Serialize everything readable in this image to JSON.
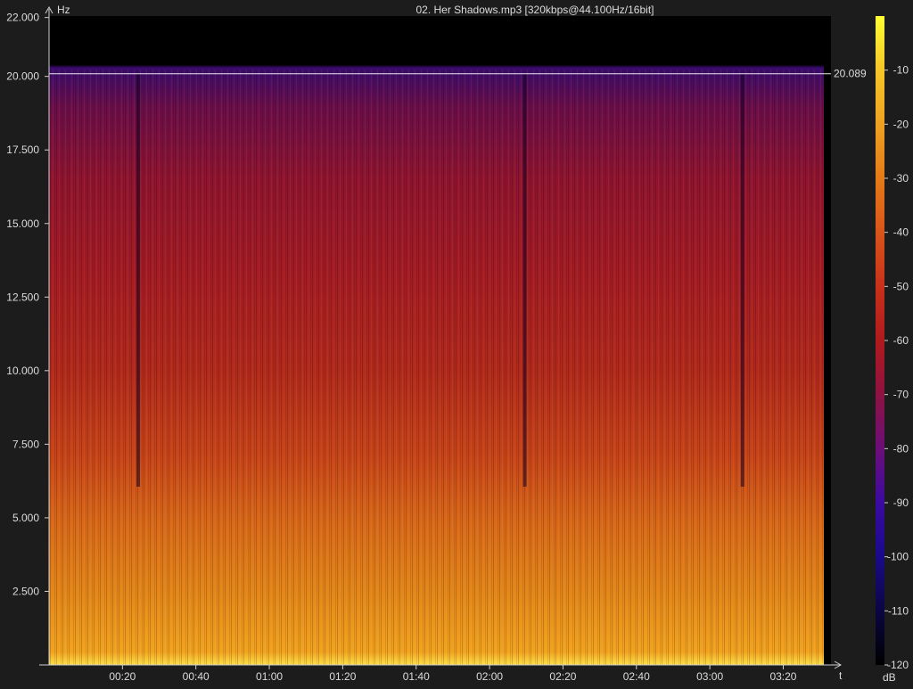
{
  "chart_data": {
    "type": "heatmap",
    "title": "02. Her Shadows.mp3 [320kbps@44.100Hz/16bit]",
    "y_unit": "Hz",
    "x_unit": "t",
    "colorbar_unit": "dB",
    "y_ticks": [
      {
        "value": 2500,
        "label": "2.500"
      },
      {
        "value": 5000,
        "label": "5.000"
      },
      {
        "value": 7500,
        "label": "7.500"
      },
      {
        "value": 10000,
        "label": "10.000"
      },
      {
        "value": 12500,
        "label": "12.500"
      },
      {
        "value": 15000,
        "label": "15.000"
      },
      {
        "value": 17500,
        "label": "17.500"
      },
      {
        "value": 20000,
        "label": "20.000"
      },
      {
        "value": 22000,
        "label": "22.000"
      }
    ],
    "ylim": [
      0,
      22050
    ],
    "x_ticks": [
      {
        "value": 20,
        "label": "00:20"
      },
      {
        "value": 40,
        "label": "00:40"
      },
      {
        "value": 60,
        "label": "01:00"
      },
      {
        "value": 80,
        "label": "01:20"
      },
      {
        "value": 100,
        "label": "01:40"
      },
      {
        "value": 120,
        "label": "02:00"
      },
      {
        "value": 140,
        "label": "02:20"
      },
      {
        "value": 160,
        "label": "02:40"
      },
      {
        "value": 180,
        "label": "03:00"
      },
      {
        "value": 200,
        "label": "03:20"
      }
    ],
    "xlim": [
      0,
      213
    ],
    "cutoff": {
      "value": 20089,
      "label": "20.089"
    },
    "colorbar": {
      "min": -120,
      "max": 0,
      "ticks": [
        {
          "value": -10,
          "label": "-10"
        },
        {
          "value": -20,
          "label": "-20"
        },
        {
          "value": -30,
          "label": "-30"
        },
        {
          "value": -40,
          "label": "-40"
        },
        {
          "value": -50,
          "label": "-50"
        },
        {
          "value": -60,
          "label": "-60"
        },
        {
          "value": -70,
          "label": "-70"
        },
        {
          "value": -80,
          "label": "-80"
        },
        {
          "value": -90,
          "label": "-90"
        },
        {
          "value": -100,
          "label": "-100"
        },
        {
          "value": -110,
          "label": "-110"
        },
        {
          "value": -120,
          "label": "-120"
        }
      ]
    },
    "gaps_seconds": [
      24.3,
      129.6,
      188.9
    ]
  }
}
